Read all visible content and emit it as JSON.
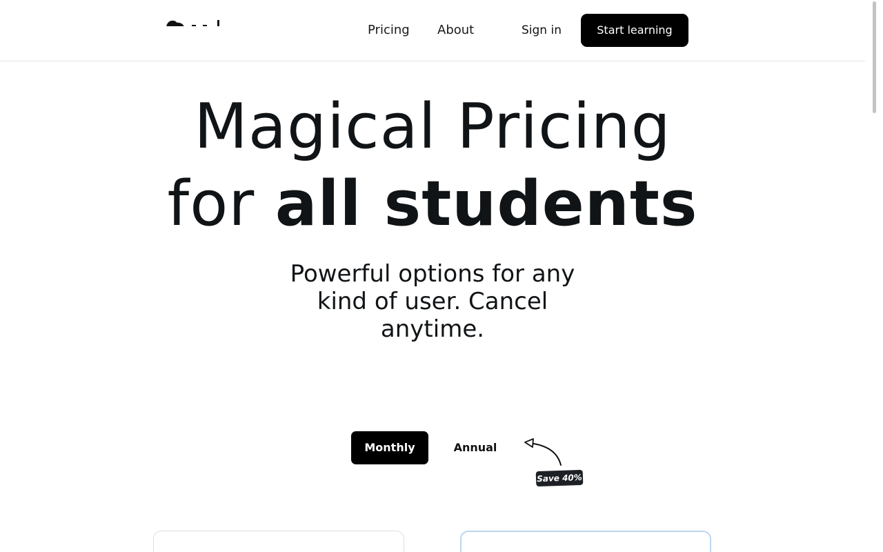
{
  "header": {
    "nav": {
      "pricing": "Pricing",
      "about": "About"
    },
    "sign_in": "Sign in",
    "cta": "Start learning"
  },
  "hero": {
    "line1": "Magical Pricing",
    "line2_prefix": "for ",
    "line2_bold": "all students",
    "subtitle": "Powerful options for any kind of user. Cancel anytime."
  },
  "billing": {
    "monthly": "Monthly",
    "annual": "Annual",
    "save_badge": "Save 40%"
  },
  "colors": {
    "primary_button": "#000000",
    "text": "#111416",
    "highlight_card_border": "#bcd5ee"
  },
  "icons": {
    "logo": "logo-mark",
    "arrow": "curved-arrow-icon"
  }
}
